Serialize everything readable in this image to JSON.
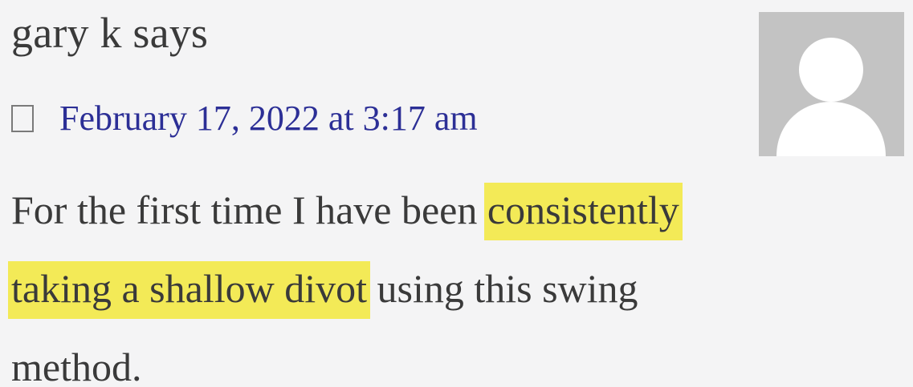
{
  "comment": {
    "author_line": "gary k says",
    "date_text": "February 17, 2022 at 3:17 am",
    "body": {
      "before_highlight": "For the first time I have been ",
      "highlight_line1": "consistently",
      "highlight_line2": "taking a shallow divot",
      "after_highlight": " using this swing",
      "last_line": "method."
    },
    "highlight_color": "#f3ea57",
    "link_color": "#2c2f96",
    "icons": {
      "date": "clock-icon",
      "avatar": "default-avatar-icon"
    }
  }
}
